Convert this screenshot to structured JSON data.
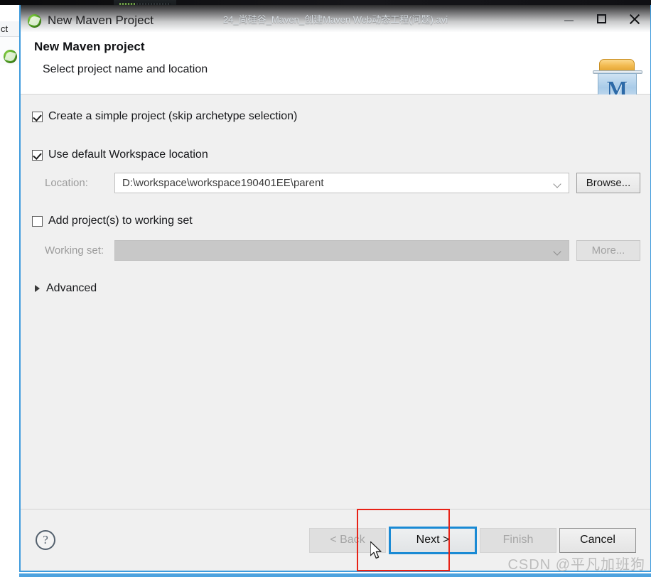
{
  "background_app": {
    "left_tab_label": "ct",
    "leaf_icon": "spring-leaf-icon"
  },
  "video_window": {
    "title": "24_尚硅谷_Maven_创建Maven Web动态工程(问题).avi",
    "overlay_widget": "video-control-overlay"
  },
  "dialog": {
    "titlebar": {
      "icon": "maven-leaf-icon",
      "title": "New Maven Project",
      "minimize_label": "minimize-icon",
      "maximize_label": "maximize-icon",
      "close_label": "close-icon"
    },
    "header": {
      "title": "New Maven project",
      "subtitle": "Select project name and location",
      "logo_letter": "M",
      "logo_name": "maven-project-icon"
    },
    "form": {
      "simple_project": {
        "label": "Create a simple project (skip archetype selection)",
        "checked": true
      },
      "default_workspace": {
        "label": "Use default Workspace location",
        "checked": true
      },
      "location": {
        "label": "Location:",
        "value": "D:\\workspace\\workspace190401EE\\parent",
        "browse_label": "Browse...",
        "enabled": true
      },
      "add_to_working_set": {
        "label": "Add project(s) to working set",
        "checked": false
      },
      "working_set": {
        "label": "Working set:",
        "value": "",
        "more_label": "More...",
        "enabled": false
      },
      "advanced": {
        "label": "Advanced",
        "expanded": false
      }
    },
    "footer": {
      "help_glyph": "?",
      "buttons": [
        {
          "label": "< Back",
          "state": "disabled",
          "name": "back-button"
        },
        {
          "label": "Next >",
          "state": "focused",
          "name": "next-button"
        },
        {
          "label": "Finish",
          "state": "disabled",
          "name": "finish-button"
        },
        {
          "label": "Cancel",
          "state": "enabled",
          "name": "cancel-button"
        }
      ]
    }
  },
  "annotation": {
    "highlight_target": "next-button",
    "color": "#e82216"
  },
  "watermark": {
    "text": "CSDN @平凡加班狗"
  },
  "colors": {
    "focus_blue": "#1a8ad4",
    "dialog_border_blue": "#3e9bdd",
    "annotation_red": "#e82216",
    "body_gray": "#f0f0f0",
    "disabled_gray": "#c8c8c8"
  }
}
